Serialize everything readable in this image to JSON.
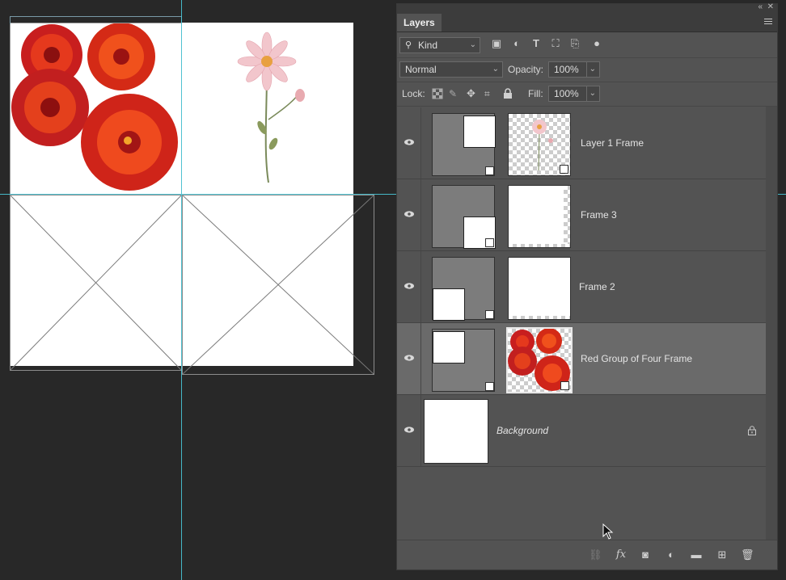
{
  "panel": {
    "tab_label": "Layers",
    "filter": {
      "label": "Kind",
      "icons": [
        "image-filter-icon",
        "adjustment-filter-icon",
        "type-filter-icon",
        "shape-filter-icon",
        "smart-object-filter-icon",
        "filter-toggle-icon"
      ]
    },
    "blend_mode": "Normal",
    "opacity_label": "Opacity:",
    "opacity_value": "100%",
    "lock_label": "Lock:",
    "fill_label": "Fill:",
    "fill_value": "100%"
  },
  "layers": [
    {
      "name": "Layer 1 Frame",
      "visible": true,
      "selected": false
    },
    {
      "name": "Frame 3",
      "visible": true,
      "selected": false
    },
    {
      "name": "Frame 2",
      "visible": true,
      "selected": false
    },
    {
      "name": "Red Group of Four Frame",
      "visible": true,
      "selected": true
    },
    {
      "name": "Background",
      "visible": true,
      "selected": false,
      "locked": true
    }
  ],
  "footer_icons": [
    "link-layers-icon",
    "fx-icon",
    "add-mask-icon",
    "new-adjustment-icon",
    "new-group-icon",
    "new-layer-icon",
    "delete-layer-icon"
  ],
  "colors": {
    "panel_bg": "#535353",
    "canvas_bg": "#282828",
    "guide": "#48c7d8",
    "selected_row": "#6a6a6a"
  }
}
